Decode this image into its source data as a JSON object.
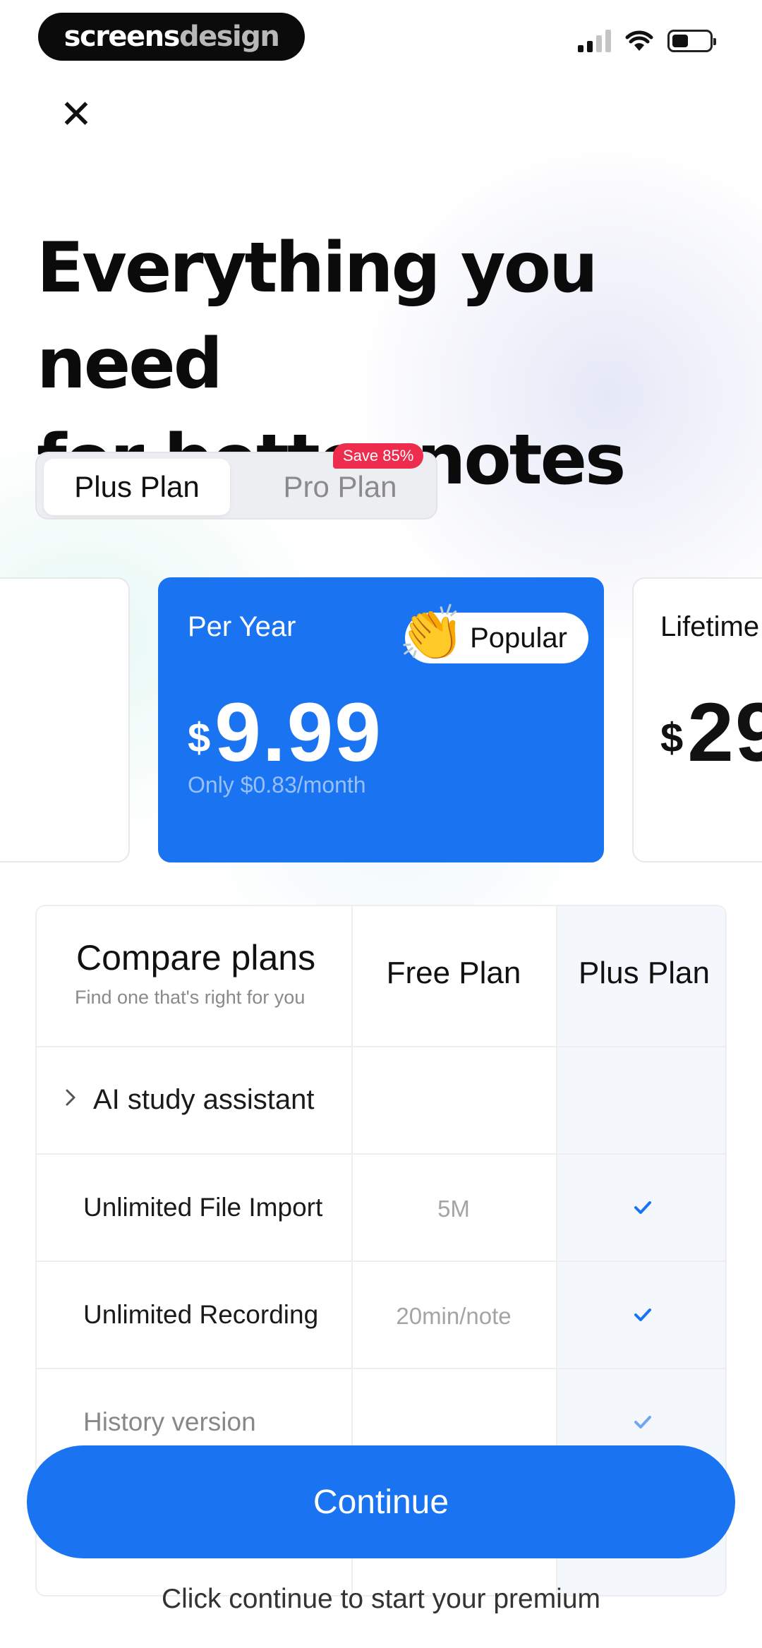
{
  "status_bar": {
    "brand_part1": "screens",
    "brand_part2": "design"
  },
  "headline": {
    "line1": "Everything you need",
    "line2": "for better notes"
  },
  "plan_toggle": {
    "active": "Plus Plan",
    "inactive": "Pro Plan",
    "badge": "Save 85%"
  },
  "cards": {
    "main": {
      "period": "Per Year",
      "badge": "Popular",
      "currency": "$",
      "amount": "9.99",
      "sub": "Only $0.83/month"
    },
    "right": {
      "period": "Lifetime",
      "currency": "$",
      "amount": "29"
    }
  },
  "compare": {
    "title": "Compare plans",
    "subtitle": "Find one that's right for you",
    "col_free": "Free Plan",
    "col_plus": "Plus Plan",
    "rows": [
      {
        "label": "AI study assistant",
        "free": "",
        "plus": false
      },
      {
        "label": "Unlimited File Import",
        "free": "5M",
        "plus": true
      },
      {
        "label": "Unlimited Recording",
        "free": "20min/note",
        "plus": true
      },
      {
        "label": "History version",
        "free": "",
        "plus": true
      }
    ]
  },
  "actions": {
    "continue": "Continue",
    "footnote": "Click continue to start your premium"
  },
  "colors": {
    "accent": "#1a73f1",
    "badge": "#ee2c4d"
  }
}
